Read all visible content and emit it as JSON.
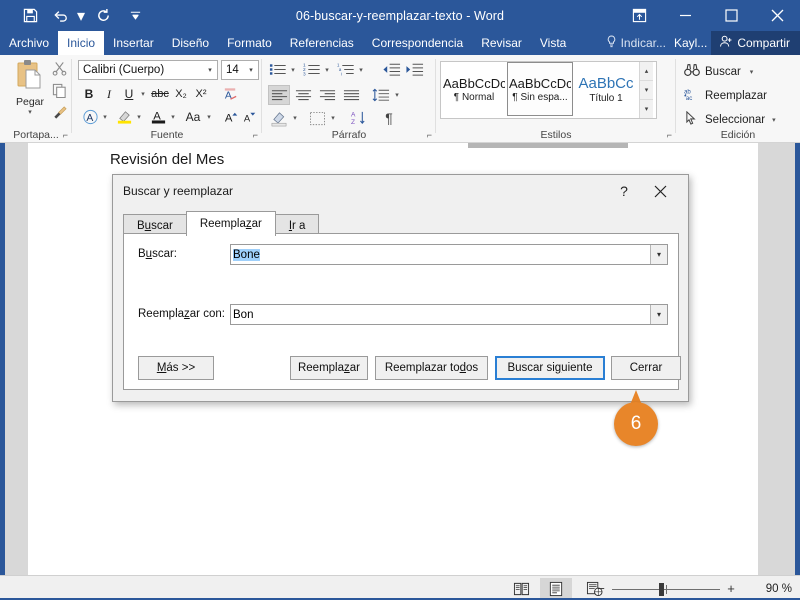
{
  "titlebar": {
    "document_title": "06-buscar-y-reemplazar-texto  -  Word",
    "qat": [
      {
        "name": "save",
        "icon": "save-icon"
      },
      {
        "name": "undo",
        "icon": "undo-icon"
      },
      {
        "name": "redo",
        "icon": "redo-icon"
      },
      {
        "name": "customize",
        "icon": "customize-qat-icon"
      }
    ],
    "window_buttons": [
      {
        "name": "ribbon-display-options",
        "icon": "ribbon-options-icon"
      },
      {
        "name": "minimize",
        "icon": "minimize-icon"
      },
      {
        "name": "maximize",
        "icon": "maximize-icon"
      },
      {
        "name": "close",
        "icon": "close-icon"
      }
    ]
  },
  "ribbon_tabs": {
    "items": [
      {
        "label": "Archivo"
      },
      {
        "label": "Inicio"
      },
      {
        "label": "Insertar"
      },
      {
        "label": "Diseño"
      },
      {
        "label": "Formato"
      },
      {
        "label": "Referencias"
      },
      {
        "label": "Correspondencia"
      },
      {
        "label": "Revisar"
      },
      {
        "label": "Vista"
      }
    ],
    "active": "Inicio",
    "tell_me": "Indicar...",
    "user": "Kayl...",
    "share": "Compartir"
  },
  "ribbon": {
    "groups": [
      {
        "label": "Portapa..."
      },
      {
        "label": "Fuente"
      },
      {
        "label": "Párrafo"
      },
      {
        "label": "Estilos"
      },
      {
        "label": "Edición"
      }
    ],
    "clipboard": {
      "paste_label": "Pegar"
    },
    "font": {
      "font_name": "Calibri (Cuerpo)",
      "font_size": "14",
      "bold": "B",
      "italic": "I",
      "underline": "U",
      "strikethrough": "abc",
      "subscript": "X₂",
      "superscript": "X²",
      "change_case": "Aa",
      "grow_font": "A",
      "shrink_font": "A",
      "text_effects": "A",
      "highlight": "ab",
      "font_color": "A"
    },
    "styles": {
      "items": [
        {
          "preview": "AaBbCcDc",
          "name": "¶ Normal",
          "selected": false,
          "heading": false
        },
        {
          "preview": "AaBbCcDc",
          "name": "¶ Sin espa...",
          "selected": true,
          "heading": false
        },
        {
          "preview": "AaBbCc",
          "name": "Título 1",
          "selected": false,
          "heading": true
        }
      ]
    },
    "editing": {
      "find": "Buscar",
      "replace": "Reemplazar",
      "select": "Seleccionar"
    }
  },
  "document": {
    "heading": "Revisión del Mes"
  },
  "dialog": {
    "title": "Buscar y reemplazar",
    "help": "?",
    "tabs": [
      {
        "label_pre": "B",
        "label_accel": "u",
        "label_post": "scar",
        "active": false
      },
      {
        "label_pre": "Reempla",
        "label_accel": "z",
        "label_post": "ar",
        "active": true
      },
      {
        "label_pre": "",
        "label_accel": "I",
        "label_post": "r a",
        "active": false
      }
    ],
    "find": {
      "label_pre": "B",
      "label_accel": "u",
      "label_post": "scar:",
      "value": "Bone",
      "selected": true
    },
    "replace": {
      "label_pre": "Reempla",
      "label_accel": "z",
      "label_post": "ar con:",
      "value": "Bon",
      "selected": false
    },
    "buttons": [
      {
        "name": "more",
        "pre": "",
        "accel": "M",
        "post": "ás >>",
        "focused": false
      },
      {
        "name": "replace",
        "pre": "Reempla",
        "accel": "z",
        "post": "ar",
        "focused": false
      },
      {
        "name": "replace-all",
        "pre": "Reemplazar to",
        "accel": "d",
        "post": "os",
        "focused": false
      },
      {
        "name": "find-next",
        "pre": "Buscar si",
        "accel": "g",
        "post": "uiente",
        "focused": true
      },
      {
        "name": "close",
        "pre": "Cerrar",
        "accel": "",
        "post": "",
        "focused": false
      }
    ]
  },
  "callout": {
    "step_number": "6",
    "color": "#e8862a"
  },
  "statusbar": {
    "views": [
      {
        "name": "read-mode",
        "active": false
      },
      {
        "name": "print-layout",
        "active": true
      },
      {
        "name": "web-layout",
        "active": false
      }
    ],
    "zoom_out": "−",
    "zoom_in": "+",
    "zoom_level": "90 %"
  },
  "theme": {
    "brand_blue": "#2b579a",
    "accent_orange": "#e8862a",
    "focus_blue": "#2a7fd4",
    "selection_blue": "#9fd0fb"
  }
}
